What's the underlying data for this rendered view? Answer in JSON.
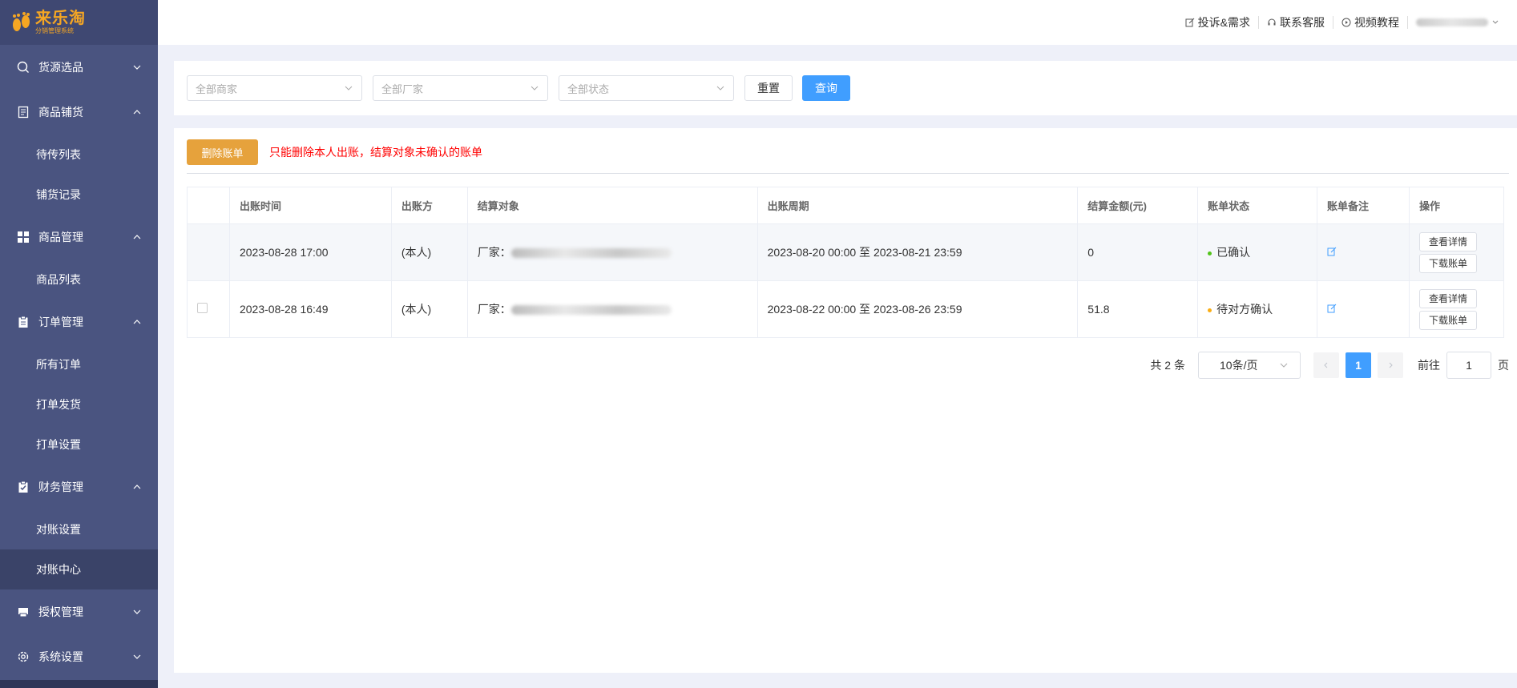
{
  "logo": {
    "title": "来乐淘",
    "subtitle": "分销管理系统"
  },
  "sidebar": {
    "items": [
      {
        "label": "货源选品",
        "icon": "search-icon",
        "expanded": false
      },
      {
        "label": "商品铺货",
        "icon": "document-icon",
        "expanded": true,
        "children": [
          "待传列表",
          "铺货记录"
        ]
      },
      {
        "label": "商品管理",
        "icon": "grid-icon",
        "expanded": true,
        "children": [
          "商品列表"
        ]
      },
      {
        "label": "订单管理",
        "icon": "clipboard-icon",
        "expanded": true,
        "children": [
          "所有订单",
          "打单发货",
          "打单设置"
        ]
      },
      {
        "label": "财务管理",
        "icon": "clipboard-check-icon",
        "expanded": true,
        "children": [
          "对账设置",
          "对账中心"
        ]
      },
      {
        "label": "授权管理",
        "icon": "printer-icon",
        "expanded": false
      },
      {
        "label": "系统设置",
        "icon": "gear-icon",
        "expanded": false
      }
    ],
    "active": "对账中心"
  },
  "topbar": {
    "complaint": "投诉&需求",
    "support": "联系客服",
    "tutorial": "视频教程"
  },
  "filters": {
    "merchant_placeholder": "全部商家",
    "factory_placeholder": "全部厂家",
    "status_placeholder": "全部状态",
    "reset_label": "重置",
    "query_label": "查询"
  },
  "toolbar": {
    "delete_label": "删除账单",
    "warning": "只能删除本人出账，结算对象未确认的账单"
  },
  "table": {
    "headers": [
      "出账时间",
      "出账方",
      "结算对象",
      "出账周期",
      "结算金额(元)",
      "账单状态",
      "账单备注",
      "操作"
    ],
    "rows": [
      {
        "time": "2023-08-28 17:00",
        "issuer": "(本人)",
        "target_prefix": "厂家：",
        "period": "2023-08-20 00:00 至 2023-08-21 23:59",
        "amount": "0",
        "status": "已确认",
        "status_color": "#52c41a",
        "view_label": "查看详情",
        "download_label": "下载账单"
      },
      {
        "time": "2023-08-28 16:49",
        "issuer": "(本人)",
        "target_prefix": "厂家：",
        "period": "2023-08-22 00:00 至 2023-08-26 23:59",
        "amount": "51.8",
        "status": "待对方确认",
        "status_color": "#faad14",
        "view_label": "查看详情",
        "download_label": "下载账单"
      }
    ]
  },
  "pagination": {
    "total": "共 2 条",
    "page_size": "10条/页",
    "current_page": "1",
    "goto_label": "前往",
    "goto_value": "1",
    "page_unit": "页"
  },
  "colors": {
    "sidebar": "#4a5480",
    "primary": "#409eff",
    "warning_button": "#e6a23c",
    "warning_text": "#ff0000"
  }
}
